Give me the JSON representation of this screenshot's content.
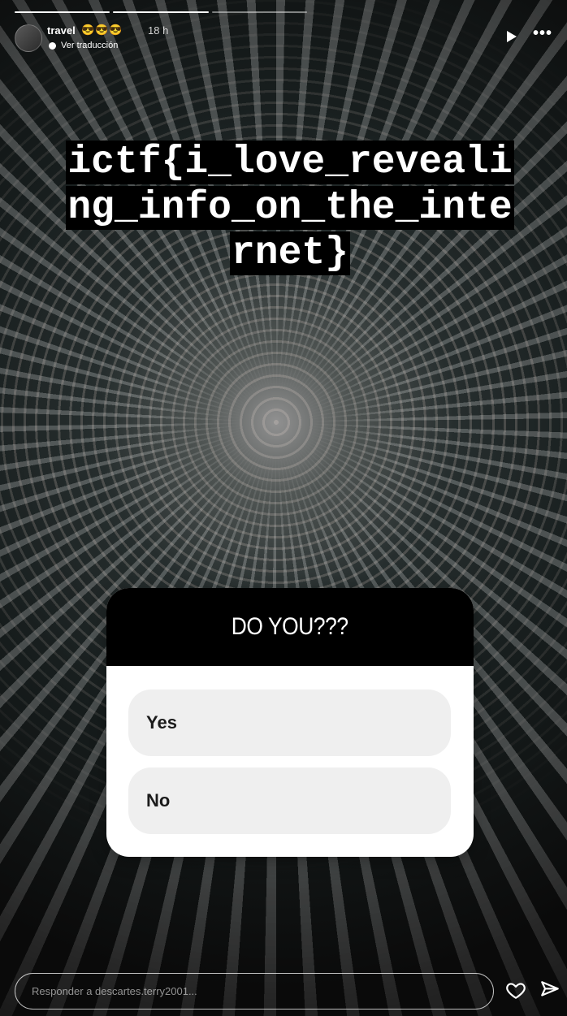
{
  "story": {
    "username": "travel",
    "emojis": "😎😎😎",
    "time": "18 h",
    "translate_label": "Ver traducción",
    "progress": {
      "total": 3,
      "completed": 2
    }
  },
  "flag_text": {
    "line1": "ictf{i_love_reveali",
    "line2": "ng_info_on_the_inte",
    "line3": "rnet}"
  },
  "poll": {
    "question": "DO YOU???",
    "options": [
      "Yes",
      "No"
    ]
  },
  "reply": {
    "placeholder": "Responder a descartes.terry2001..."
  },
  "icons": [
    "play-icon",
    "more-icon",
    "heart-icon",
    "send-icon",
    "globe-icon"
  ],
  "colors": {
    "poll_header": "#000000",
    "poll_option_bg": "#efefef"
  }
}
